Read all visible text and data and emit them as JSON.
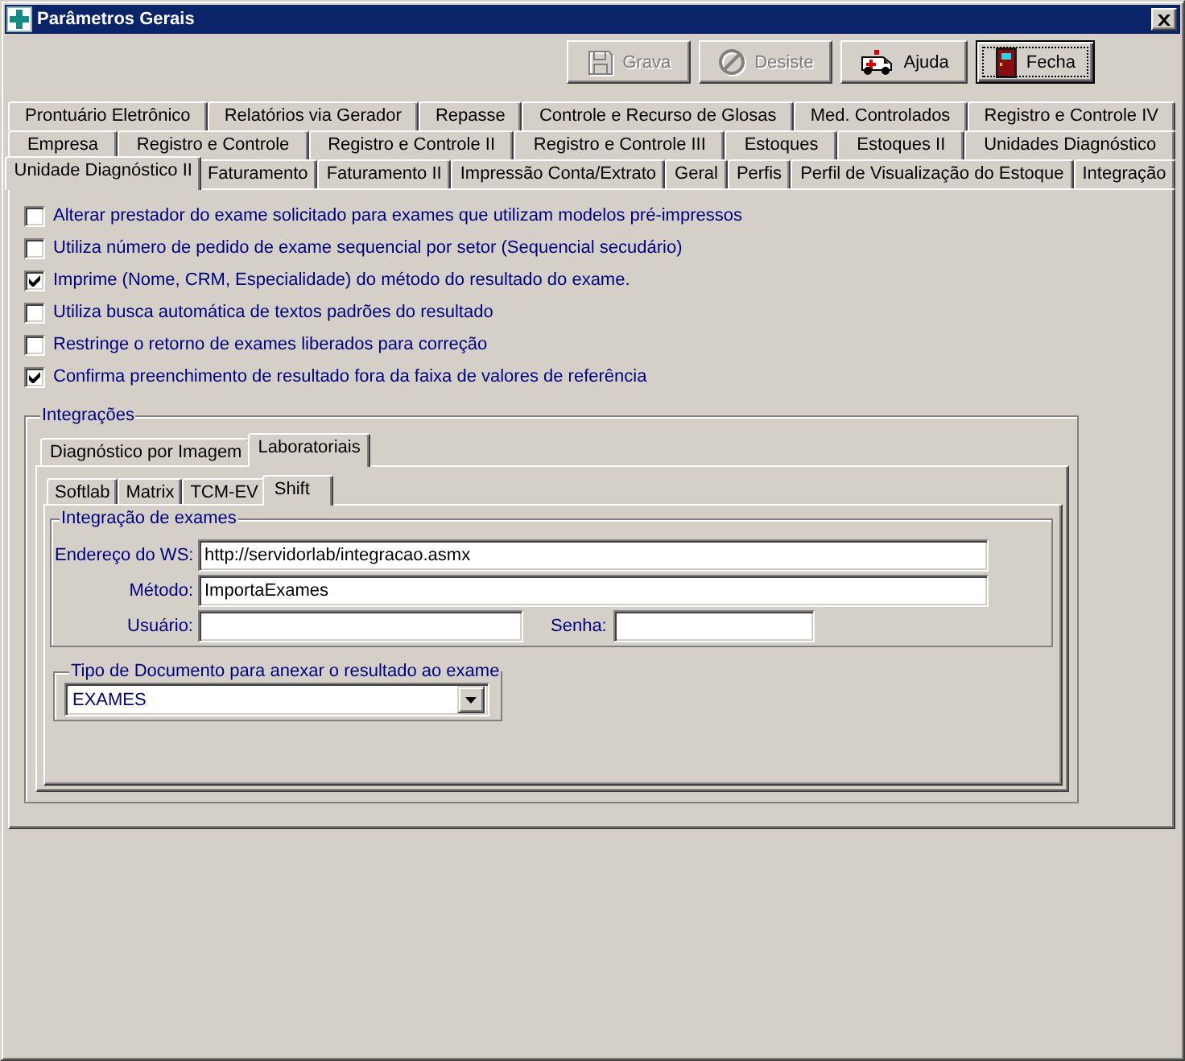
{
  "window": {
    "title": "Parâmetros Gerais"
  },
  "toolbar": [
    {
      "kind": "save",
      "label": "Grava",
      "disabled": true,
      "focused": false
    },
    {
      "kind": "cancel",
      "label": "Desiste",
      "disabled": true,
      "focused": false
    },
    {
      "kind": "help",
      "label": "Ajuda",
      "disabled": false,
      "focused": false
    },
    {
      "kind": "exit",
      "label": "Fecha",
      "disabled": false,
      "focused": true
    }
  ],
  "tab_rows": [
    {
      "tabs": [
        {
          "label": "Prontuário Eletrônico",
          "selected": false
        },
        {
          "label": "Relatórios via Gerador",
          "selected": false
        },
        {
          "label": "Repasse",
          "selected": false
        },
        {
          "label": "Controle e Recurso de Glosas",
          "selected": false
        },
        {
          "label": "Med. Controlados",
          "selected": false
        },
        {
          "label": "Registro e Controle IV",
          "selected": false
        }
      ]
    },
    {
      "tabs": [
        {
          "label": "Empresa",
          "selected": false
        },
        {
          "label": "Registro e Controle",
          "selected": false
        },
        {
          "label": "Registro e Controle II",
          "selected": false
        },
        {
          "label": "Registro e Controle III",
          "selected": false
        },
        {
          "label": "Estoques",
          "selected": false
        },
        {
          "label": "Estoques II",
          "selected": false
        },
        {
          "label": "Unidades Diagnóstico",
          "selected": false
        }
      ]
    },
    {
      "tabs": [
        {
          "label": "Unidade Diagnóstico II",
          "selected": true
        },
        {
          "label": "Faturamento",
          "selected": false
        },
        {
          "label": "Faturamento II",
          "selected": false
        },
        {
          "label": "Impressão Conta/Extrato",
          "selected": false
        },
        {
          "label": "Geral",
          "selected": false
        },
        {
          "label": "Perfis",
          "selected": false
        },
        {
          "label": "Perfil de Visualização do Estoque",
          "selected": false
        },
        {
          "label": "Integração",
          "selected": false
        }
      ]
    }
  ],
  "options": [
    {
      "label": "Alterar prestador do exame solicitado para exames que utilizam modelos pré-impressos",
      "checked": false
    },
    {
      "label": "Utiliza número de pedido de exame sequencial por setor (Sequencial secudário)",
      "checked": false
    },
    {
      "label": "Imprime (Nome, CRM, Especialidade) do método do resultado do exame.",
      "checked": true
    },
    {
      "label": "Utiliza busca automática de textos padrões do resultado",
      "checked": false
    },
    {
      "label": "Restringe o retorno de exames liberados para correção",
      "checked": false
    },
    {
      "label": "Confirma preenchimento de resultado fora da faixa de valores de referência",
      "checked": true
    }
  ],
  "integrations": {
    "title": "Integrações",
    "tabs": [
      {
        "label": "Diagnóstico por Imagem",
        "selected": false
      },
      {
        "label": "Laboratoriais",
        "selected": true
      }
    ],
    "sub_tabs": [
      {
        "label": "Softlab",
        "selected": false
      },
      {
        "label": "Matrix",
        "selected": false
      },
      {
        "label": "TCM-EV",
        "selected": false
      },
      {
        "label": "Shift",
        "selected": true
      }
    ],
    "exam_group": {
      "title": "Integração de exames",
      "rows": [
        {
          "fields": [
            {
              "label": "Endereço do WS:",
              "value": "http://servidorlab/integracao.asmx"
            }
          ]
        },
        {
          "fields": [
            {
              "label": "Método:",
              "value": "ImportaExames"
            }
          ]
        },
        {
          "fields": [
            {
              "label": "Usuário:"
            },
            {
              "label": "Senha:"
            }
          ]
        }
      ]
    },
    "document_type": {
      "title": "Tipo de Documento para anexar o resultado ao exame",
      "value": "EXAMES"
    }
  }
}
